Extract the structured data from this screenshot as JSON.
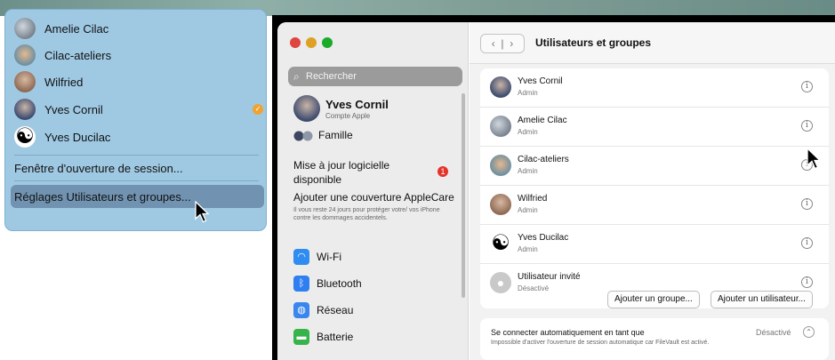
{
  "user_menu": {
    "users": [
      {
        "name": "Amelie Cilac"
      },
      {
        "name": "Cilac-ateliers"
      },
      {
        "name": "Wilfried"
      },
      {
        "name": "Yves Cornil",
        "badge": true
      },
      {
        "name": "Yves Ducilac"
      }
    ],
    "login_window": "Fenêtre d'ouverture de session...",
    "settings_item": "Réglages Utilisateurs et groupes..."
  },
  "window": {
    "search_placeholder": "Rechercher",
    "account": {
      "name": "Yves Cornil",
      "subtitle": "Compte Apple"
    },
    "famille": "Famille",
    "update": {
      "text": "Mise à jour logicielle disponible",
      "badge": "1"
    },
    "applecare": {
      "title": "Ajouter une couverture AppleCare",
      "desc": "Il vous reste 24 jours pour protéger votre/ vos iPhone contre les dommages accidentels."
    },
    "sidebar_items": [
      {
        "label": "Wi-Fi",
        "icon": "wifi-icon",
        "color": "#2f8cf0"
      },
      {
        "label": "Bluetooth",
        "icon": "bluetooth-icon",
        "color": "#2f7ff0"
      },
      {
        "label": "Réseau",
        "icon": "globe-icon",
        "color": "#3a86ee"
      },
      {
        "label": "Batterie",
        "icon": "battery-icon",
        "color": "#36b34a"
      }
    ],
    "title": "Utilisateurs et groupes",
    "users": [
      {
        "name": "Yves Cornil",
        "role": "Admin"
      },
      {
        "name": "Amelie Cilac",
        "role": "Admin"
      },
      {
        "name": "Cilac-ateliers",
        "role": "Admin"
      },
      {
        "name": "Wilfried",
        "role": "Admin"
      },
      {
        "name": "Yves Ducilac",
        "role": "Admin"
      },
      {
        "name": "Utilisateur invité",
        "role": "Désactivé"
      }
    ],
    "add_group": "Ajouter un groupe...",
    "add_user": "Ajouter un utilisateur...",
    "auto_login": {
      "title": "Se connecter automatiquement en tant que",
      "desc": "Impossible d'activer l'ouverture de session automatique car FileVault est activé.",
      "value": "Désactivé"
    }
  },
  "colors": {
    "menu_bg": "#9fc9e3",
    "menu_highlight": "#7193b1",
    "red_light": "#e0443e",
    "yellow_light": "#dea123",
    "green_light": "#1aab29"
  }
}
